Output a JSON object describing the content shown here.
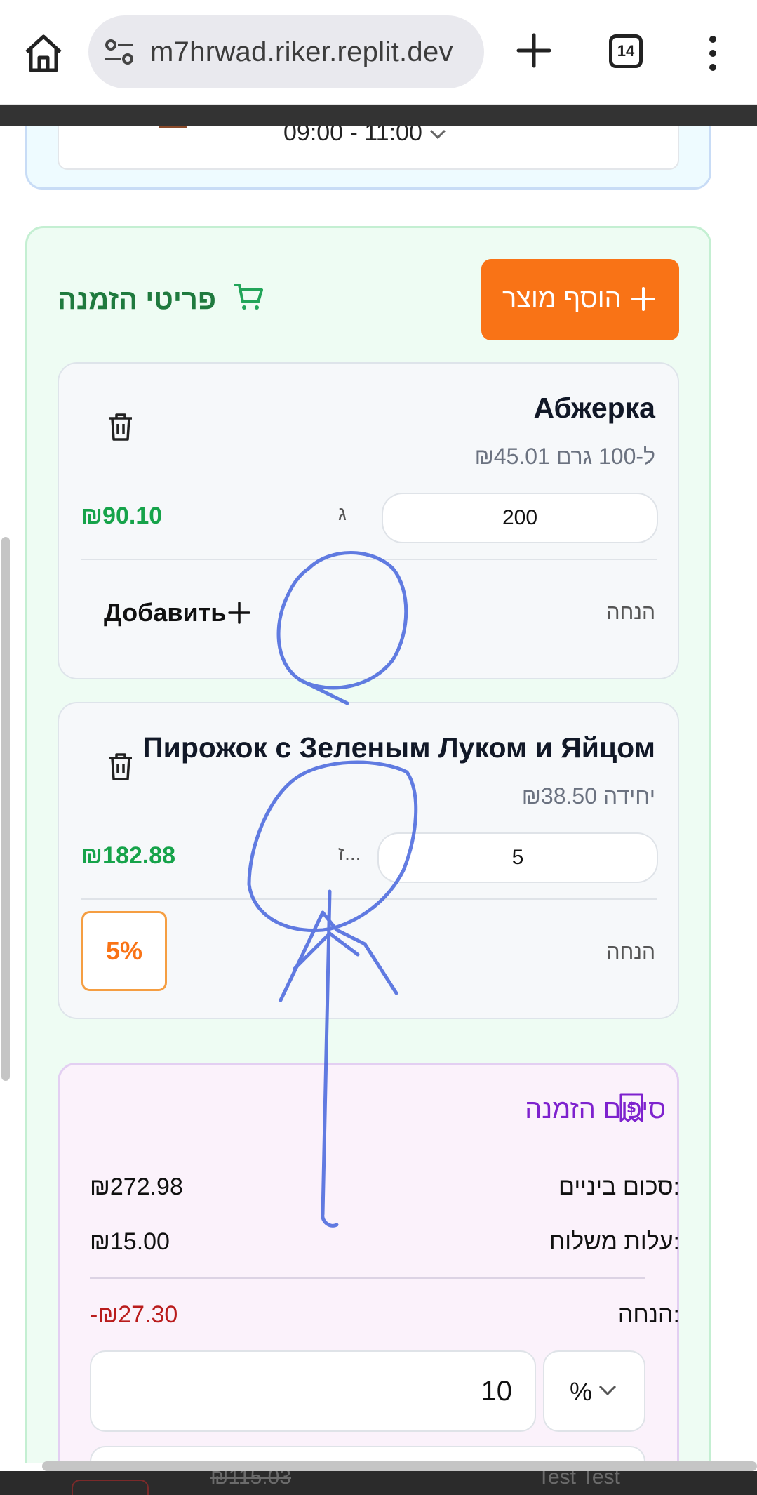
{
  "browser": {
    "url": "m7hrwad.riker.replit.dev",
    "tab_count": "14"
  },
  "delivery": {
    "time_slot": "09:00 - 11:00"
  },
  "order": {
    "title": "פריטי הזמנה",
    "add_product_label": "הוסף מוצר",
    "items": [
      {
        "name": "Абжерка",
        "price_per": "₪45.01 ל-100 גרם",
        "quantity": "200",
        "unit": "ג",
        "total": "₪90.10",
        "discount_label": "הנחה",
        "add_discount_label": "Добавить"
      },
      {
        "name": "Пирожок с Зеленым Луком и Яйцом",
        "price_per": "₪38.50 יחידה",
        "quantity": "5",
        "unit": "ז...",
        "total": "₪182.88",
        "discount_label": "הנחה",
        "discount_badge": "5%"
      }
    ]
  },
  "summary": {
    "title": "סיכום הזמנה",
    "subtotal_label": "סכום ביניים:",
    "subtotal_value": "₪272.98",
    "shipping_label": "עלות משלוח:",
    "shipping_value": "₪15.00",
    "discount_label": "הנחה:",
    "discount_value": "-₪27.30",
    "discount_input_value": "10",
    "discount_type": "%"
  },
  "bottom_peek": {
    "strike_price": "₪115.03",
    "customer_name": "Test Test"
  },
  "colors": {
    "accent_orange": "#f97316",
    "total_green": "#16a34a",
    "title_green": "#1f7a3e",
    "summary_purple": "#7e22ce",
    "discount_red": "#b91c1c",
    "annotation_blue": "#3b5bdb"
  }
}
